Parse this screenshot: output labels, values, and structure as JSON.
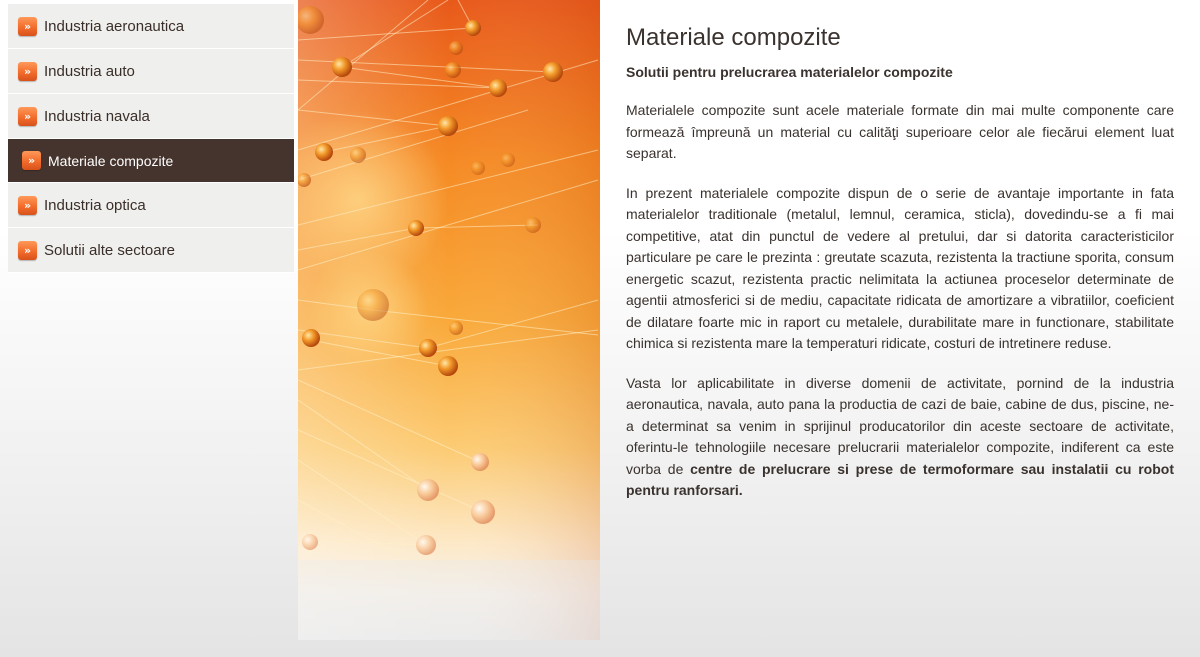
{
  "sidebar": {
    "items": [
      {
        "label": "Industria aeronautica",
        "active": false
      },
      {
        "label": "Industria auto",
        "active": false
      },
      {
        "label": "Industria navala",
        "active": false
      },
      {
        "label": "Materiale compozite",
        "active": true
      },
      {
        "label": "Industria optica",
        "active": false
      },
      {
        "label": "Solutii alte sectoare",
        "active": false
      }
    ],
    "arrow_glyph": "»"
  },
  "main": {
    "title": "Materiale compozite",
    "subtitle": "Solutii pentru prelucrarea materialelor compozite",
    "paragraph1": "Materialele compozite sunt acele materiale formate din mai multe componente care formează împreună un material cu calităţi superioare celor ale fiecărui element luat separat.",
    "paragraph2": "In prezent materialele compozite dispun de o serie de avantaje importante in fata materialelor traditionale (metalul, lemnul, ceramica, sticla), dovedindu-se a fi mai competitive, atat din punctul de vedere al pretului, dar si datorita caracteristicilor particulare pe care le prezinta : greutate scazuta, rezistenta la tractiune sporita, consum energetic scazut, rezistenta practic nelimitata la actiunea proceselor determinate de agentii atmosferici si de mediu, capacitate ridicata de amortizare a vibratiilor, coeficient de dilatare foarte mic in raport cu metalele, durabilitate mare in functionare, stabilitate chimica si rezistenta mare la temperaturi ridicate, costuri de intretinere reduse.",
    "paragraph3_text": "Vasta lor aplicabilitate in diverse domenii de activitate, pornind de la industria aeronautica, navala, auto pana la productia de cazi de baie, cabine de dus, piscine, ne-a determinat sa venim in sprijinul producatorilor din aceste sectoare de activitate, oferintu-le tehnologiile necesare prelucrarii materialelor compozite, indiferent ca este vorba de",
    "paragraph3_bold": "centre de prelucrare si prese de termoformare sau instalatii cu robot pentru ranforsari."
  },
  "colors": {
    "active_nav_bg": "#45342d",
    "accent_orange": "#f26c2c",
    "text": "#3a322e"
  },
  "image": {
    "subject": "orange molecular network"
  }
}
